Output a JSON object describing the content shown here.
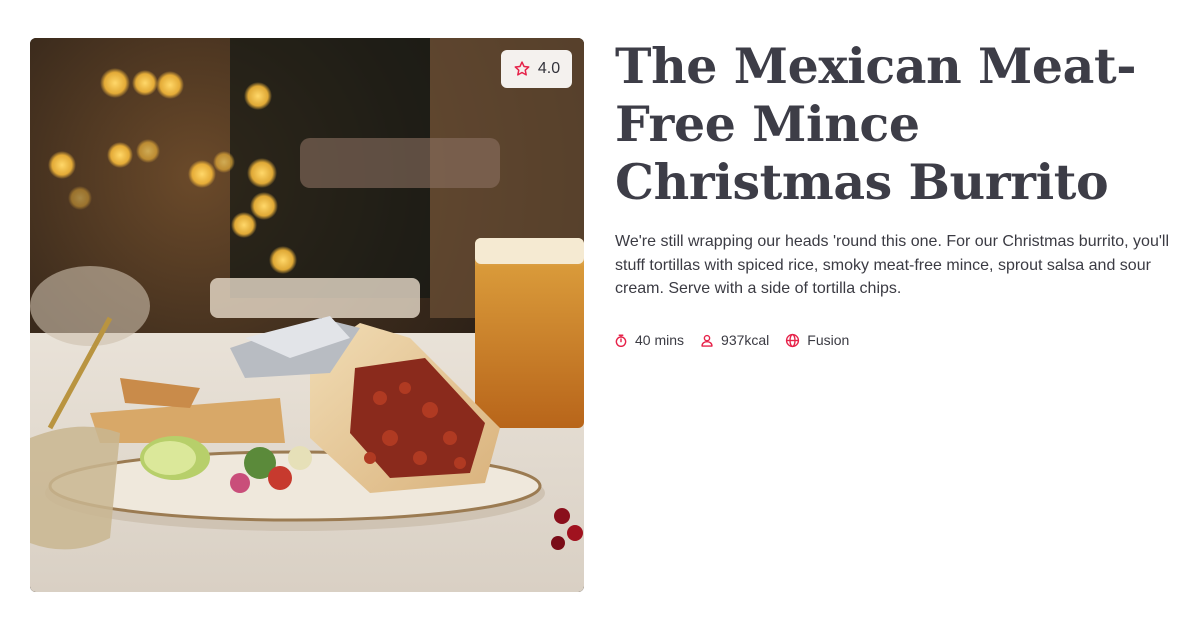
{
  "recipe": {
    "title": "The Mexican Meat-Free Mince Christmas Burrito",
    "description": "We're still wrapping our heads 'round this one. For our Christmas burrito, you'll stuff tortillas with spiced rice, smoky meat-free mince, sprout salsa and sour cream. Serve with a side of tortilla chips.",
    "rating": "4.0",
    "rating_icon": "star-outline-icon",
    "meta": {
      "time": "40 mins",
      "time_icon": "stopwatch-icon",
      "calories": "937kcal",
      "calories_icon": "person-icon",
      "cuisine": "Fusion",
      "cuisine_icon": "globe-icon"
    }
  },
  "colors": {
    "accent": "#e6234a",
    "text": "#3d3d47",
    "badge_bg": "#f4f1ee"
  }
}
